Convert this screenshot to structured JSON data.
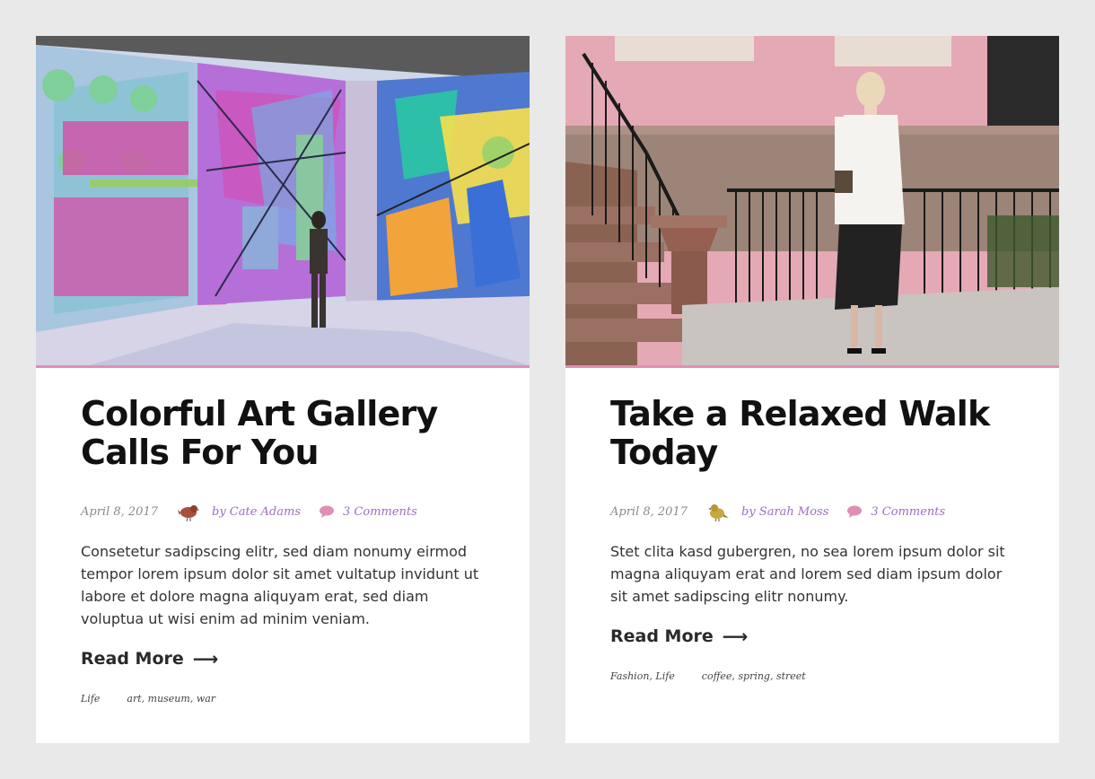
{
  "posts": [
    {
      "title": "Colorful Art Gallery Calls For You",
      "date": "April 8, 2017",
      "author": "by Cate Adams",
      "comments": "3 Comments",
      "excerpt": "Consetetur sadipscing elitr, sed diam nonumy eirmod tempor lorem ipsum dolor sit amet vultatup invidunt ut labore et dolore magna aliquyam erat, sed diam voluptua ut wisi enim ad minim veniam.",
      "read_more": "Read More",
      "categories": "Life",
      "tags": "art, museum, war",
      "image_icon": "gallery-photo",
      "avatar_icon": "bird-avatar-brown"
    },
    {
      "title": "Take a Relaxed Walk Today",
      "date": "April 8, 2017",
      "author": "by Sarah Moss",
      "comments": "3 Comments",
      "excerpt": "Stet clita kasd gubergren, no sea lorem ipsum dolor sit magna aliquyam erat and lorem sed diam ipsum dolor sit amet sadipscing elitr nonumy.",
      "read_more": "Read More",
      "categories": "Fashion, Life",
      "tags": "coffee, spring, street",
      "image_icon": "street-photo",
      "avatar_icon": "bird-avatar-yellow"
    }
  ],
  "colors": {
    "accent_pink": "#e08fb4",
    "link_purple": "#9b6fc6",
    "title": "#111111",
    "background": "#e9e9e9"
  }
}
